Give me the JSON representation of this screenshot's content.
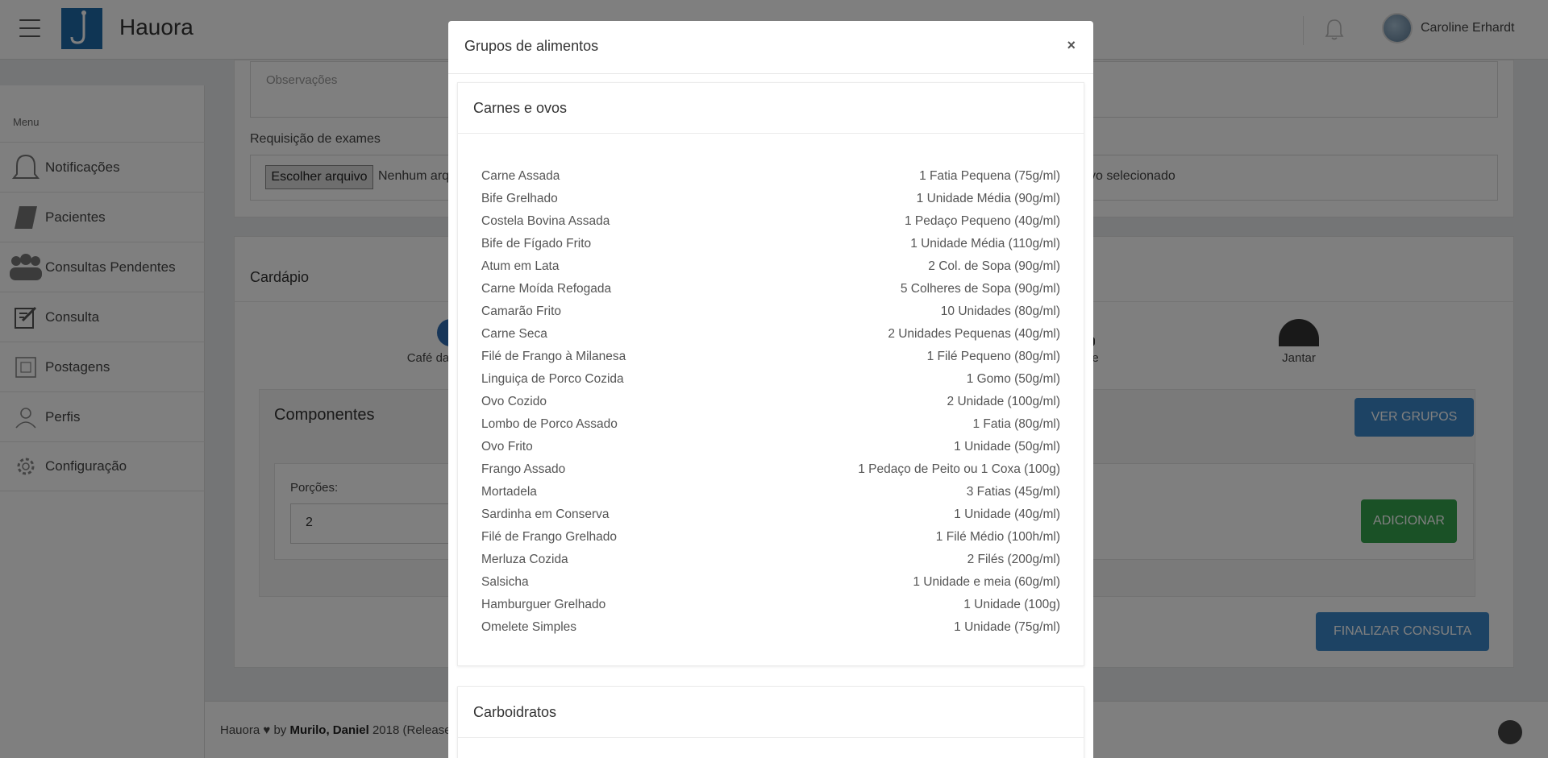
{
  "header": {
    "app_name": "Hauora",
    "user_name": "Caroline Erhardt",
    "icons": {
      "menu": "hamburger-icon",
      "notifications": "bell-icon",
      "logo": "hook-logo"
    }
  },
  "sidebar": {
    "menu_label": "Menu",
    "items": [
      {
        "label": "Notificações",
        "icon": "bell-icon"
      },
      {
        "label": "Pacientes",
        "icon": "book-icon"
      },
      {
        "label": "Consultas Pendentes",
        "icon": "users-icon"
      },
      {
        "label": "Consulta",
        "icon": "edit-icon"
      },
      {
        "label": "Postagens",
        "icon": "square-icon"
      },
      {
        "label": "Perfis",
        "icon": "user-icon"
      },
      {
        "label": "Configuração",
        "icon": "gear-icon"
      }
    ]
  },
  "main": {
    "observacoes_placeholder": "Observações",
    "requisicao_label": "Requisição de exames",
    "file_button": "Escolher arquivo",
    "file_status_left": "Nenhum arq",
    "file_status_right": "vo selecionado",
    "cardapio_title": "Cardápio",
    "meals": {
      "left": "Café da",
      "middle": "he",
      "right": "Jantar"
    },
    "componentes_title": "Componentes",
    "ver_grupos_button": "VER GRUPOS",
    "porcoes_label": "Porções:",
    "porcoes_value": "2",
    "adicionar_button": "ADICIONAR",
    "finalizar_button": "FINALIZAR CONSULTA"
  },
  "footer": {
    "prefix": "Hauora ♥ by ",
    "authors": "Murilo, Daniel",
    "suffix": " 2018 (Release"
  },
  "modal": {
    "title": "Grupos de alimentos",
    "close_symbol": "×",
    "groups": [
      {
        "name": "Carnes e ovos",
        "items": [
          {
            "food": "Carne Assada",
            "portion": "1 Fatia Pequena (75g/ml)"
          },
          {
            "food": "Bife Grelhado",
            "portion": "1 Unidade Média (90g/ml)"
          },
          {
            "food": "Costela Bovina Assada",
            "portion": "1 Pedaço Pequeno (40g/ml)"
          },
          {
            "food": "Bife de Fígado Frito",
            "portion": "1 Unidade Média (110g/ml)"
          },
          {
            "food": "Atum em Lata",
            "portion": "2 Col. de Sopa (90g/ml)"
          },
          {
            "food": "Carne Moída Refogada",
            "portion": "5 Colheres de Sopa (90g/ml)"
          },
          {
            "food": "Camarão Frito",
            "portion": "10 Unidades (80g/ml)"
          },
          {
            "food": "Carne Seca",
            "portion": "2 Unidades Pequenas (40g/ml)"
          },
          {
            "food": "Filé de Frango à Milanesa",
            "portion": "1 Filé Pequeno (80g/ml)"
          },
          {
            "food": "Linguiça de Porco Cozida",
            "portion": "1 Gomo (50g/ml)"
          },
          {
            "food": "Ovo Cozido",
            "portion": "2 Unidade (100g/ml)"
          },
          {
            "food": "Lombo de Porco Assado",
            "portion": "1 Fatia (80g/ml)"
          },
          {
            "food": "Ovo Frito",
            "portion": "1 Unidade (50g/ml)"
          },
          {
            "food": "Frango Assado",
            "portion": "1 Pedaço de Peito ou 1 Coxa (100g)"
          },
          {
            "food": "Mortadela",
            "portion": "3 Fatias (45g/ml)"
          },
          {
            "food": "Sardinha em Conserva",
            "portion": "1 Unidade (40g/ml)"
          },
          {
            "food": "Filé de Frango Grelhado",
            "portion": "1 Filé Médio (100h/ml)"
          },
          {
            "food": "Merluza Cozida",
            "portion": "2 Filés (200g/ml)"
          },
          {
            "food": "Salsicha",
            "portion": "1 Unidade e meia (60g/ml)"
          },
          {
            "food": "Hamburguer Grelhado",
            "portion": "1 Unidade (100g)"
          },
          {
            "food": "Omelete Simples",
            "portion": "1 Unidade (75g/ml)"
          }
        ]
      },
      {
        "name": "Carboidratos",
        "items": []
      }
    ]
  }
}
